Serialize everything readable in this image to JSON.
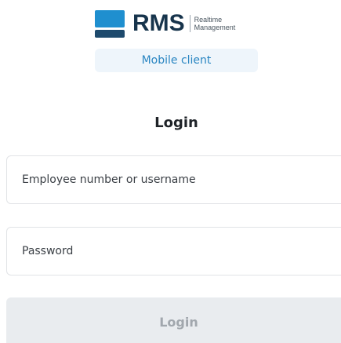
{
  "brand": {
    "name": "RMS",
    "tagline_line1": "Realtime",
    "tagline_line2": "Management",
    "badge": "Mobile client"
  },
  "form": {
    "title": "Login",
    "username_placeholder": "Employee number or username",
    "password_placeholder": "Password",
    "submit_label": "Login"
  },
  "colors": {
    "brand_blue": "#1f8fcf",
    "brand_navy": "#1e4a6d",
    "badge_bg": "#eef5fb",
    "badge_text": "#2a86c2",
    "button_disabled_bg": "#e9ecef",
    "button_disabled_text": "#a1a7ad"
  },
  "icons": {
    "logo": "rms-logo-icon"
  }
}
